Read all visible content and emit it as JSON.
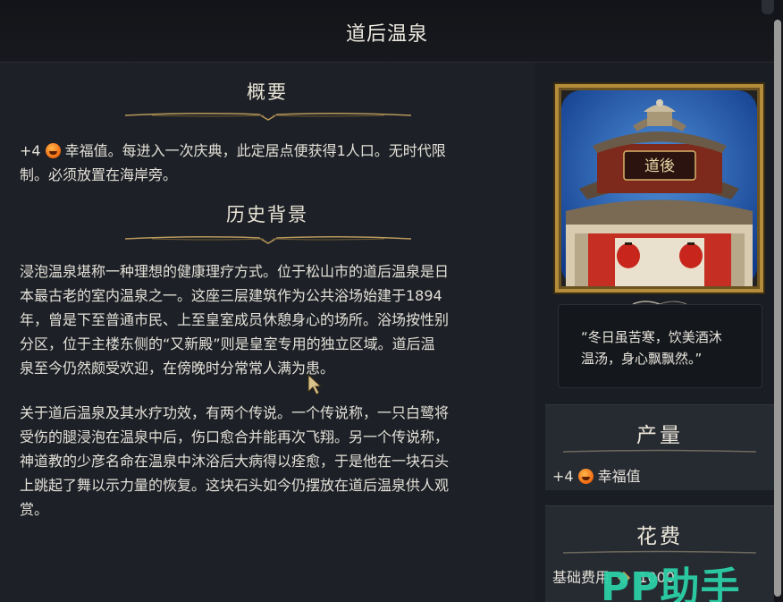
{
  "header": {
    "title": "道后温泉"
  },
  "overview": {
    "heading": "概要",
    "prefix": "+4",
    "text_line1": "幸福值。每进入一次庆典，此定居点便获得1人口。无时代限",
    "text_line2": "制。必须放置在海岸旁。"
  },
  "history": {
    "heading": "历史背景",
    "para1": [
      "浸泡温泉堪称一种理想的健康理疗方式。位于松山市的道后温泉是日",
      "本最古老的室内温泉之一。这座三层建筑作为公共浴场始建于1894",
      "年，曾是下至普通市民、上至皇室成员休憩身心的场所。浴场按性别",
      "分区，位于主楼东侧的“又新殿”则是皇室专用的独立区域。道后温",
      "泉至今仍然颇受欢迎，在傍晚时分常常人满为患。"
    ],
    "para2": [
      "关于道后温泉及其水疗功效，有两个传说。一个传说称，一只白鹭将",
      "受伤的腿浸泡在温泉中后，伤口愈合并能再次飞翔。另一个传说称，",
      "神道教的少彦名命在温泉中沐浴后大病得以痊愈，于是他在一块石头",
      "上跳起了舞以示力量的恢复。这块石头如今仍摆放在道后温泉供人观",
      "赏。"
    ]
  },
  "portrait": {
    "sign": "道後"
  },
  "quote": {
    "line1": "“冬日虽苦寒，饮美酒沐",
    "line2": "温汤，身心飘飘然。”"
  },
  "yield": {
    "heading": "产量",
    "prefix": "+4",
    "label": "幸福值",
    "icon": "happiness-emoji-icon"
  },
  "cost": {
    "heading": "花费",
    "label": "基础费用",
    "value": "1000"
  },
  "watermark": {
    "text": "PP助手"
  },
  "colors": {
    "accent_gold": "#b48d3c",
    "watermark": "#2bd0a8",
    "happiness": "#f06a12"
  }
}
